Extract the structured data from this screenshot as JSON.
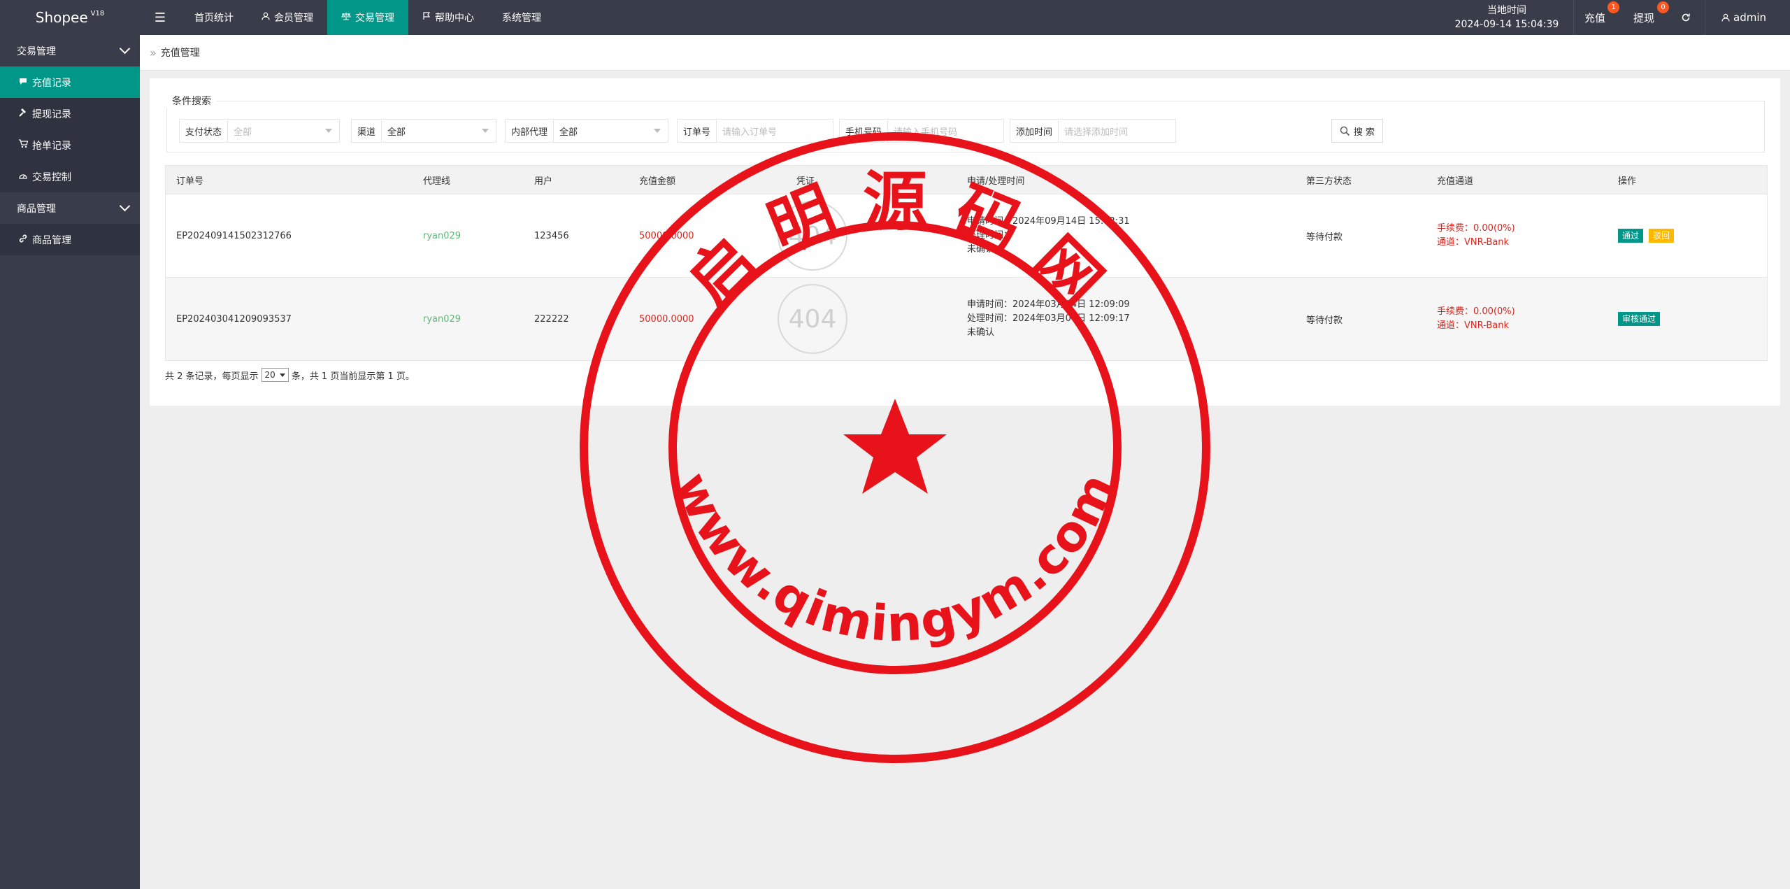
{
  "app": {
    "name": "Shopee",
    "version": "V18"
  },
  "topnav": [
    {
      "label": "首页统计",
      "icon": ""
    },
    {
      "label": "会员管理",
      "icon": "user-icon"
    },
    {
      "label": "交易管理",
      "icon": "scale-icon",
      "active": true
    },
    {
      "label": "帮助中心",
      "icon": "flag-icon"
    },
    {
      "label": "系统管理",
      "icon": ""
    }
  ],
  "header": {
    "clock_label": "当地时间",
    "clock_value": "2024-09-14 15:04:39",
    "recharge_label": "充值",
    "recharge_badge": "1",
    "withdraw_label": "提现",
    "withdraw_badge": "0",
    "user_label": "admin"
  },
  "sidebar": {
    "groups": [
      {
        "label": "交易管理",
        "items": [
          {
            "label": "充值记录",
            "icon": "chat-icon",
            "active": true
          },
          {
            "label": "提现记录",
            "icon": "hammer-icon"
          },
          {
            "label": "抢单记录",
            "icon": "cart-icon"
          },
          {
            "label": "交易控制",
            "icon": "gauge-icon"
          }
        ]
      },
      {
        "label": "商品管理",
        "items": [
          {
            "label": "商品管理",
            "icon": "link-icon"
          }
        ]
      }
    ]
  },
  "breadcrumb": "充值管理",
  "search": {
    "legend": "条件搜索",
    "pay_status_label": "支付状态",
    "pay_status_value": "全部",
    "channel_label": "渠道",
    "channel_value": "全部",
    "agent_label": "内部代理",
    "agent_value": "全部",
    "order_label": "订单号",
    "order_placeholder": "请输入订单号",
    "phone_label": "手机号码",
    "phone_placeholder": "请输入手机号码",
    "time_label": "添加时间",
    "time_placeholder": "请选择添加时间",
    "button_label": "搜 索"
  },
  "table": {
    "headers": [
      "订单号",
      "代理线",
      "用户",
      "充值金额",
      "凭证",
      "申请/处理时间",
      "第三方状态",
      "充值通道",
      "操作"
    ],
    "rows": [
      {
        "order": "EP202409141502312766",
        "agent": "ryan029",
        "user": "123456",
        "amount": "50000.0000",
        "proof": "404",
        "apply_time": "申请时间：2024年09月14日 15:02:31",
        "process_time": "处理时间：",
        "confirm": "未确认",
        "third_status": "等待付款",
        "fee": "手续费：0.00(0%)",
        "channel": "通道：VNR-Bank",
        "actions": [
          "通过",
          "驳回"
        ]
      },
      {
        "order": "EP202403041209093537",
        "agent": "ryan029",
        "user": "222222",
        "amount": "50000.0000",
        "proof": "404",
        "apply_time": "申请时间：2024年03月04日 12:09:09",
        "process_time": "处理时间：2024年03月04日 12:09:17",
        "confirm": "未确认",
        "third_status": "等待付款",
        "fee": "手续费：0.00(0%)",
        "channel": "通道：VNR-Bank",
        "actions": [
          "审核通过"
        ]
      }
    ]
  },
  "pagination": {
    "prefix": "共 2 条记录，每页显示",
    "page_size": "20",
    "suffix": "条，共 1 页当前显示第 1 页。"
  },
  "watermark": {
    "top_text": "启 明 源 码 网",
    "bottom_text": "www.qimingym.com",
    "color": "#e8121a"
  },
  "colors": {
    "accent": "#009688",
    "topbar": "#393d49",
    "warning": "#ffb800",
    "danger": "#d9251d",
    "success": "#5fb878"
  }
}
